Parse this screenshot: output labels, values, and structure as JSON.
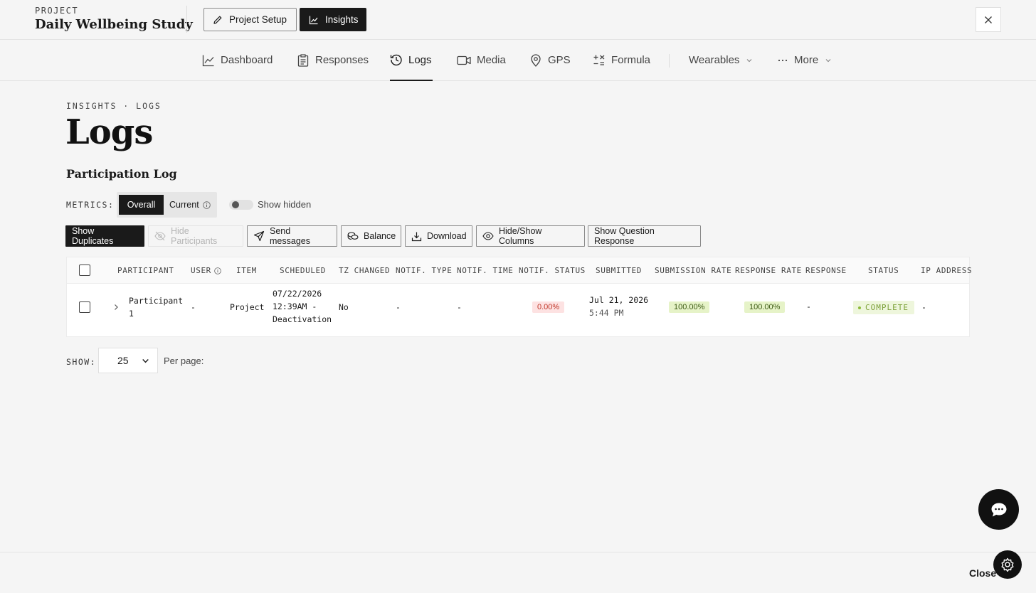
{
  "header": {
    "project_label": "PROJECT",
    "project_name": "Daily Wellbeing Study",
    "setup_label": "Project Setup",
    "insights_label": "Insights"
  },
  "nav": {
    "items": [
      {
        "label": "Dashboard",
        "icon": "chart-line-icon"
      },
      {
        "label": "Responses",
        "icon": "clipboard-icon"
      },
      {
        "label": "Logs",
        "icon": "history-icon",
        "active": true
      },
      {
        "label": "Media",
        "icon": "video-icon"
      },
      {
        "label": "GPS",
        "icon": "map-pin-icon"
      },
      {
        "label": "Formula",
        "icon": "formula-icon"
      },
      {
        "label": "Wearables",
        "icon": "chevron-down-icon"
      },
      {
        "label": "More",
        "icon": "ellipsis-icon"
      }
    ]
  },
  "page": {
    "breadcrumb": "INSIGHTS · LOGS",
    "title": "Logs",
    "section_title": "Participation Log"
  },
  "metrics": {
    "label": "METRICS:",
    "overall": "Overall",
    "current": "Current",
    "show_hidden": "Show hidden",
    "show_hidden_on": false
  },
  "toolbar": {
    "show_duplicates": "Show Duplicates",
    "hide_participants": "Hide Participants",
    "send_messages": "Send messages",
    "balance": "Balance",
    "download": "Download",
    "hide_show_columns": "Hide/Show Columns",
    "show_question_response": "Show Question Response"
  },
  "table": {
    "headers": [
      "PARTICIPANT",
      "USER",
      "ITEM",
      "SCHEDULED",
      "TZ CHANGED",
      "NOTIF. TYPE",
      "NOTIF. TIME",
      "NOTIF. STATUS",
      "SUBMITTED",
      "SUBMISSION RATE",
      "RESPONSE RATE",
      "RESPONSE",
      "STATUS",
      "IP ADDRESS"
    ],
    "rows": [
      {
        "participant_line1": "Participant",
        "participant_line2": "1",
        "user": "-",
        "item": "Project",
        "scheduled_line1": "07/22/2026",
        "scheduled_line2": "12:39AM -",
        "scheduled_line3": "Deactivation",
        "tz_changed": "No",
        "notif_type": "-",
        "notif_time": "-",
        "notif_status": "0.00%",
        "submitted_line1": "Jul 21, 2026",
        "submitted_line2": "5:44 PM",
        "submission_rate": "100.00%",
        "response_rate": "100.00%",
        "response": "-",
        "status": "COMPLETE",
        "ip_address": "-"
      }
    ]
  },
  "pagination": {
    "show_label": "SHOW:",
    "page_size": "25",
    "per_page_label": "Per page:"
  },
  "footer": {
    "close_label": "Close"
  },
  "colors": {
    "accent": "#1a1a1a",
    "background": "#f5f5f5",
    "error_bg": "#fde2e2",
    "error_text": "#c0392b",
    "success_bg": "#e6f3c8",
    "status_text": "#7da13a"
  }
}
